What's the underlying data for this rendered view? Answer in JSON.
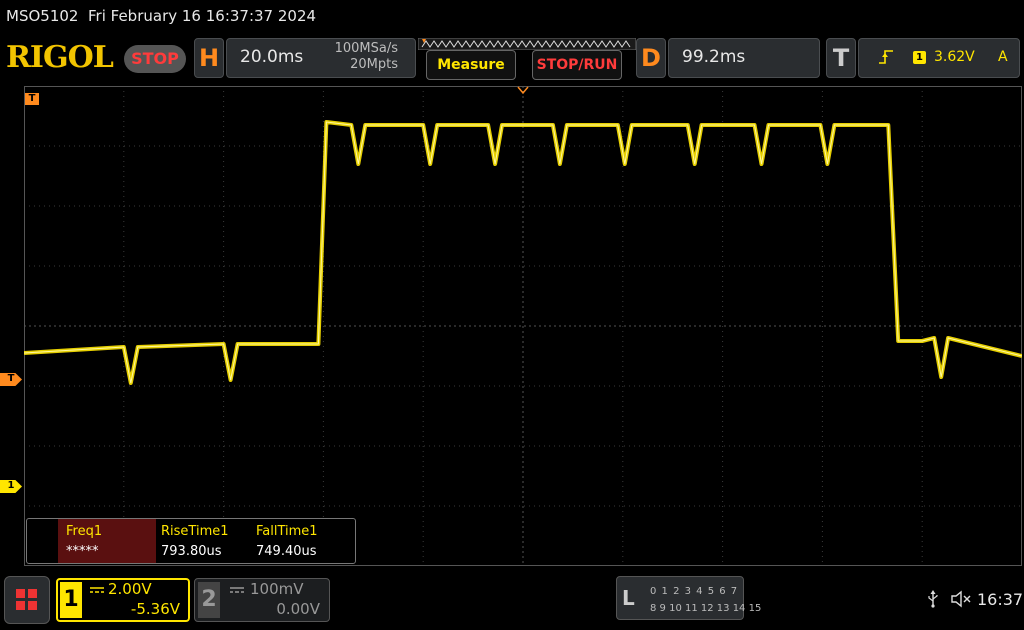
{
  "status_line": {
    "model": "MSO5102",
    "datetime": "Fri February 16 16:37:37 2024"
  },
  "header": {
    "logo": "RIGOL",
    "run_state": "STOP",
    "horizontal": {
      "letter": "H",
      "timebase": "20.0ms",
      "sample_rate": "100MSa/s",
      "memory_depth": "20Mpts"
    },
    "measure_label": "Measure",
    "stoprun_label": "STOP/RUN",
    "delay": {
      "letter": "D",
      "value": "99.2ms"
    },
    "trigger": {
      "letter": "T",
      "source": "1",
      "level": "3.62V",
      "mode": "A",
      "edge_icon": "rising-edge-icon"
    }
  },
  "markers": {
    "trigger_top": "T",
    "trigger_level": "T",
    "channel1": "1"
  },
  "measurements": [
    {
      "name": "Freq1",
      "value": "*****"
    },
    {
      "name": "RiseTime1",
      "value": "793.80us"
    },
    {
      "name": "FallTime1",
      "value": "749.40us"
    }
  ],
  "channels": [
    {
      "number": "1",
      "scale": "2.00V",
      "offset": "-5.36V",
      "coupling_icon": "dc-coupling-icon"
    },
    {
      "number": "2",
      "scale": "100mV",
      "offset": "0.00V",
      "coupling_icon": "dc-coupling-icon"
    }
  ],
  "logic_analyzer": {
    "letter": "L",
    "row1": "0 1 2 3  4 5 6 7",
    "row2": "8 9 10 11 12 13 14 15"
  },
  "system_tray": {
    "time": "16:37",
    "icons": [
      "usb-icon",
      "sound-muted-icon"
    ]
  },
  "colors": {
    "ch1": "#ffe600",
    "trigger": "#ff8a1e",
    "stop": "#ff3b3b",
    "grid": "#3a3a3a"
  },
  "chart_data": {
    "type": "line",
    "series": [
      {
        "name": "1",
        "color": "#ffe600",
        "x_divisions": [
          0,
          1.0,
          1.07,
          1.14,
          2.0,
          2.07,
          2.14,
          2.95,
          3.03,
          3.28,
          3.35,
          3.42,
          4.0,
          4.07,
          4.14,
          4.65,
          4.72,
          4.79,
          5.3,
          5.37,
          5.44,
          5.95,
          6.02,
          6.09,
          6.65,
          6.72,
          6.79,
          7.32,
          7.39,
          7.46,
          7.98,
          8.05,
          8.12,
          8.66,
          8.76,
          9.0,
          9.12,
          9.19,
          9.26,
          10.0
        ],
        "y_divisions": [
          -0.45,
          -0.35,
          -0.95,
          -0.35,
          -0.3,
          -0.9,
          -0.3,
          -0.3,
          3.4,
          3.35,
          2.7,
          3.35,
          3.35,
          2.7,
          3.35,
          3.35,
          2.7,
          3.35,
          3.35,
          2.7,
          3.35,
          3.35,
          2.7,
          3.35,
          3.35,
          2.7,
          3.35,
          3.35,
          2.7,
          3.35,
          3.35,
          2.7,
          3.35,
          3.35,
          -0.25,
          -0.25,
          -0.2,
          -0.85,
          -0.2,
          -0.5
        ]
      }
    ],
    "xlim": [
      0,
      10
    ],
    "ylim": [
      -4,
      4
    ],
    "x_unit": "div",
    "y_unit": "div",
    "grid": true
  }
}
